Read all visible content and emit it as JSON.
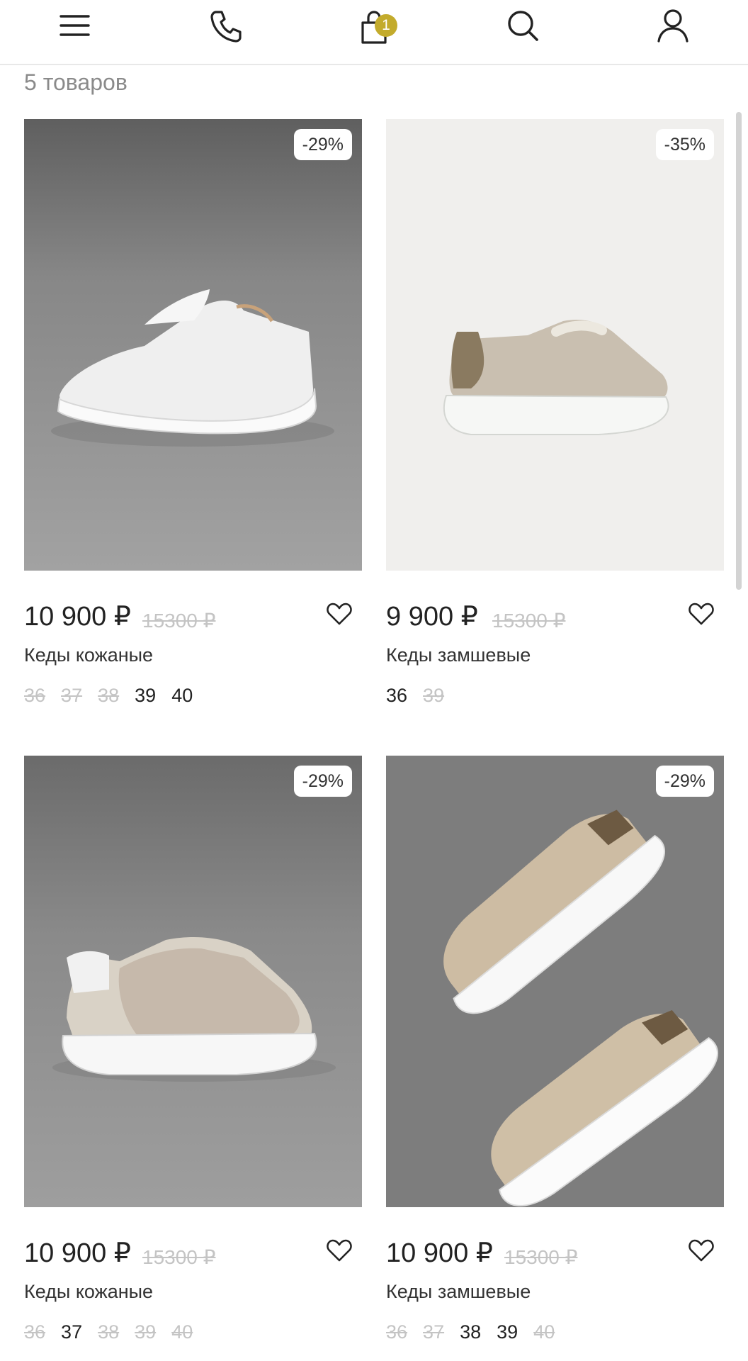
{
  "header": {
    "icons": [
      "menu-icon",
      "phone-icon",
      "cart-icon",
      "search-icon",
      "user-icon"
    ],
    "cart_count": "1",
    "accent_color": "#c3ab2c"
  },
  "listing": {
    "count_label": "5 товаров"
  },
  "products": [
    {
      "discount": "-29%",
      "price": "10 900 ₽",
      "old_price": "15300 ₽",
      "title": "Кеды кожаные",
      "sizes": [
        {
          "label": "36",
          "available": false
        },
        {
          "label": "37",
          "available": false
        },
        {
          "label": "38",
          "available": false
        },
        {
          "label": "39",
          "available": true
        },
        {
          "label": "40",
          "available": true
        }
      ]
    },
    {
      "discount": "-35%",
      "price": "9 900 ₽",
      "old_price": "15300 ₽",
      "title": "Кеды замшевые",
      "sizes": [
        {
          "label": "36",
          "available": true
        },
        {
          "label": "39",
          "available": false
        }
      ]
    },
    {
      "discount": "-29%",
      "price": "10 900 ₽",
      "old_price": "15300 ₽",
      "title": "Кеды кожаные",
      "sizes": [
        {
          "label": "36",
          "available": false
        },
        {
          "label": "37",
          "available": true
        },
        {
          "label": "38",
          "available": false
        },
        {
          "label": "39",
          "available": false
        },
        {
          "label": "40",
          "available": false
        }
      ]
    },
    {
      "discount": "-29%",
      "price": "10 900 ₽",
      "old_price": "15300 ₽",
      "title": "Кеды замшевые",
      "sizes": [
        {
          "label": "36",
          "available": false
        },
        {
          "label": "37",
          "available": false
        },
        {
          "label": "38",
          "available": true
        },
        {
          "label": "39",
          "available": true
        },
        {
          "label": "40",
          "available": false
        }
      ]
    }
  ]
}
